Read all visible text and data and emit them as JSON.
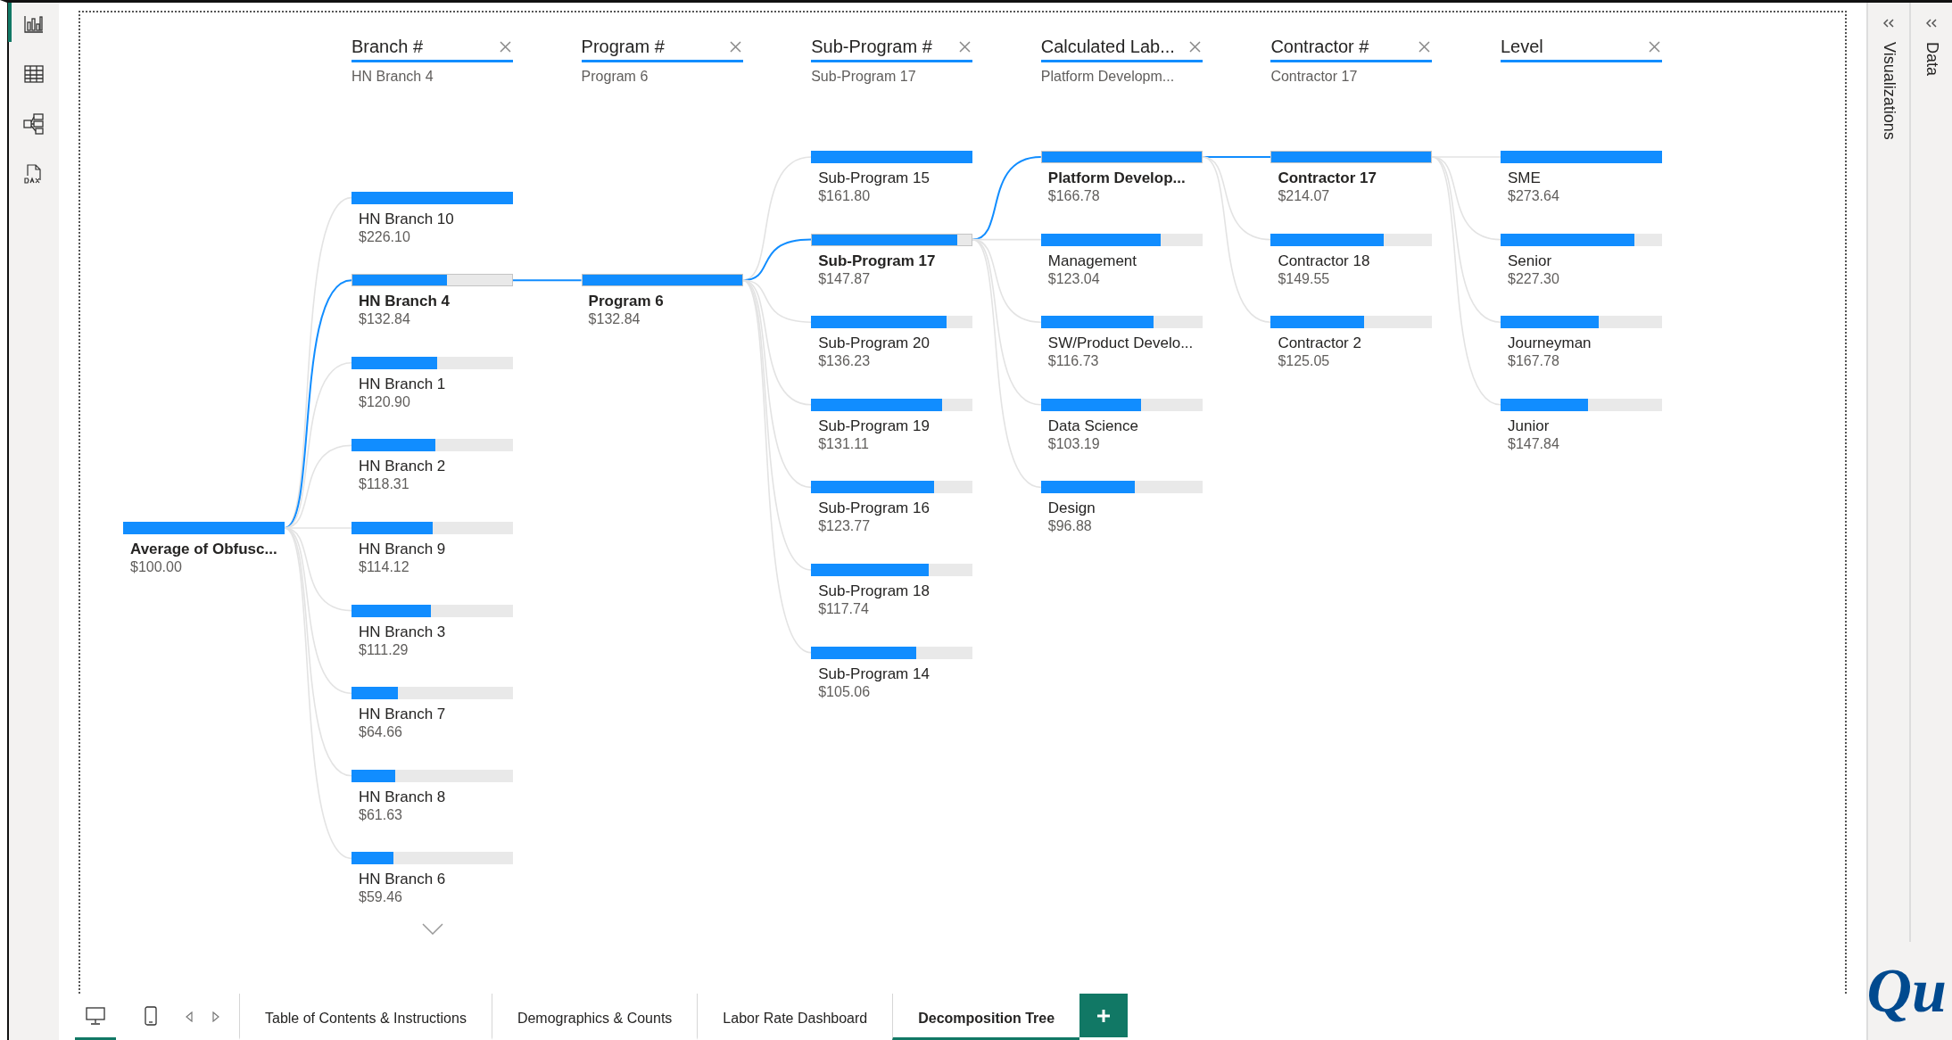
{
  "rail": [
    {
      "kind": "report",
      "selected": true
    },
    {
      "kind": "table",
      "selected": false
    },
    {
      "kind": "model",
      "selected": false
    },
    {
      "kind": "dax",
      "selected": false
    }
  ],
  "tree": {
    "root": {
      "label": "Average of Obfusc...",
      "value": "$100.00"
    },
    "levels": [
      {
        "title": "Branch #",
        "filter": "HN Branch 4",
        "has_more": true,
        "nodes": [
          {
            "label": "HN Branch 10",
            "value": "$226.10",
            "level": 1,
            "selected": false
          },
          {
            "label": "HN Branch 4",
            "value": "$132.84",
            "level": 0.59,
            "selected": true
          },
          {
            "label": "HN Branch 1",
            "value": "$120.90",
            "level": 0.53,
            "selected": false
          },
          {
            "label": "HN Branch 2",
            "value": "$118.31",
            "level": 0.52,
            "selected": false
          },
          {
            "label": "HN Branch 9",
            "value": "$114.12",
            "level": 0.5,
            "selected": false
          },
          {
            "label": "HN Branch 3",
            "value": "$111.29",
            "level": 0.49,
            "selected": false
          },
          {
            "label": "HN Branch 7",
            "value": "$64.66",
            "level": 0.29,
            "selected": false
          },
          {
            "label": "HN Branch 8",
            "value": "$61.63",
            "level": 0.27,
            "selected": false
          },
          {
            "label": "HN Branch 6",
            "value": "$59.46",
            "level": 0.26,
            "selected": false
          }
        ]
      },
      {
        "title": "Program #",
        "filter": "Program 6",
        "nodes": [
          {
            "label": "Program 6",
            "value": "$132.84",
            "level": 1,
            "selected": true
          }
        ]
      },
      {
        "title": "Sub-Program #",
        "filter": "Sub-Program 17",
        "nodes": [
          {
            "label": "Sub-Program 15",
            "value": "$161.80",
            "level": 1,
            "selected": false
          },
          {
            "label": "Sub-Program 17",
            "value": "$147.87",
            "level": 0.91,
            "selected": true
          },
          {
            "label": "Sub-Program 20",
            "value": "$136.23",
            "level": 0.84,
            "selected": false
          },
          {
            "label": "Sub-Program 19",
            "value": "$131.11",
            "level": 0.81,
            "selected": false
          },
          {
            "label": "Sub-Program 16",
            "value": "$123.77",
            "level": 0.76,
            "selected": false
          },
          {
            "label": "Sub-Program 18",
            "value": "$117.74",
            "level": 0.73,
            "selected": false
          },
          {
            "label": "Sub-Program 14",
            "value": "$105.06",
            "level": 0.65,
            "selected": false
          }
        ]
      },
      {
        "title": "Calculated Lab...",
        "filter": "Platform Developm...",
        "nodes": [
          {
            "label": "Platform Develop...",
            "value": "$166.78",
            "level": 1,
            "selected": true
          },
          {
            "label": "Management",
            "value": "$123.04",
            "level": 0.74,
            "selected": false
          },
          {
            "label": "SW/Product Develo...",
            "value": "$116.73",
            "level": 0.7,
            "selected": false
          },
          {
            "label": "Data Science",
            "value": "$103.19",
            "level": 0.62,
            "selected": false
          },
          {
            "label": "Design",
            "value": "$96.88",
            "level": 0.58,
            "selected": false
          }
        ]
      },
      {
        "title": "Contractor #",
        "filter": "Contractor 17",
        "nodes": [
          {
            "label": "Contractor 17",
            "value": "$214.07",
            "level": 1,
            "selected": true
          },
          {
            "label": "Contractor 18",
            "value": "$149.55",
            "level": 0.7,
            "selected": false
          },
          {
            "label": "Contractor 2",
            "value": "$125.05",
            "level": 0.58,
            "selected": false
          }
        ]
      },
      {
        "title": "Level",
        "nodes": [
          {
            "label": "SME",
            "value": "$273.64",
            "level": 1,
            "selected": false
          },
          {
            "label": "Senior",
            "value": "$227.30",
            "level": 0.83,
            "selected": false
          },
          {
            "label": "Journeyman",
            "value": "$167.78",
            "level": 0.61,
            "selected": false
          },
          {
            "label": "Junior",
            "value": "$147.84",
            "level": 0.54,
            "selected": false
          }
        ]
      }
    ]
  },
  "panes": [
    {
      "title": "Visualizations"
    },
    {
      "title": "Data"
    }
  ],
  "logo": "Qu",
  "views": [
    {
      "kind": "desktop",
      "selected": true
    },
    {
      "kind": "phone",
      "selected": false
    }
  ],
  "tabs": [
    {
      "label": "Table of Contents & Instructions",
      "selected": false
    },
    {
      "label": "Demographics & Counts",
      "selected": false
    },
    {
      "label": "Labor Rate Dashboard",
      "selected": false
    },
    {
      "label": "Decomposition Tree",
      "selected": true
    }
  ]
}
